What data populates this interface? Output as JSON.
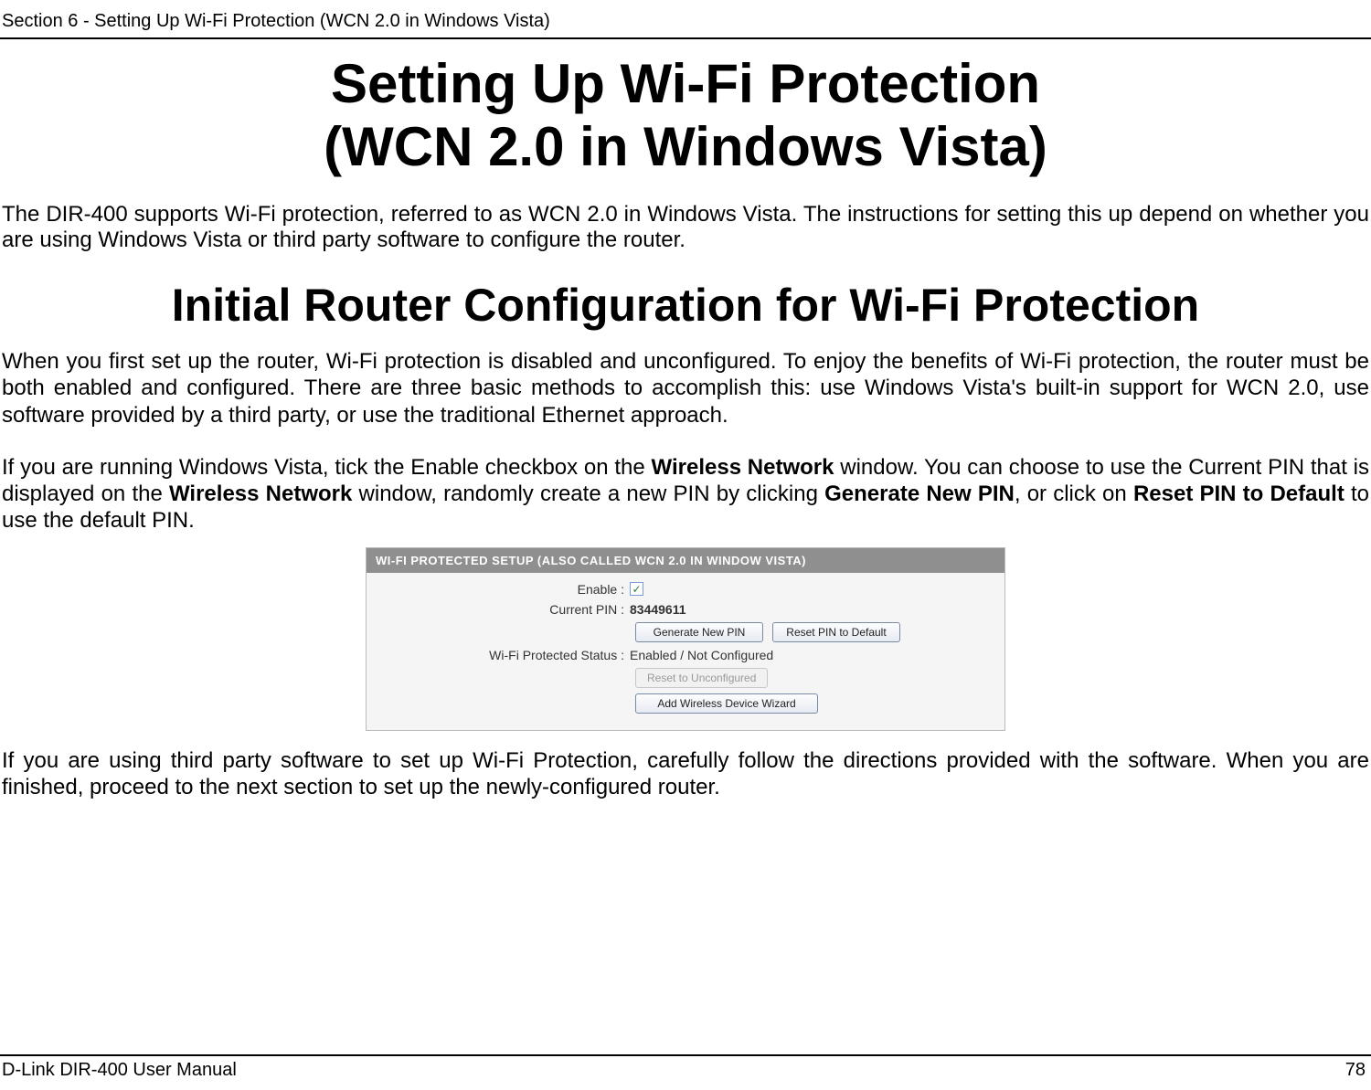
{
  "header": {
    "section_label": "Section 6 - Setting Up Wi-Fi Protection (WCN 2.0 in Windows Vista)"
  },
  "title": {
    "line1": "Setting Up Wi-Fi Protection",
    "line2": "(WCN 2.0 in Windows Vista)"
  },
  "intro": "The DIR-400 supports Wi-Fi protection, referred to as WCN 2.0 in Windows Vista. The instructions for setting this up depend on whether you are using Windows Vista or third party software to configure the router.",
  "subtitle": "Initial Router Configuration for Wi-Fi Protection",
  "para1": "When you first set up the router, Wi-Fi protection is disabled and unconfigured. To enjoy the benefits of Wi-Fi protection, the router must be both enabled and configured. There are three basic methods to accomplish this: use Windows Vista's built-in support for WCN 2.0, use software provided by a third party, or use the traditional Ethernet approach.",
  "para2_pre": "If you are running Windows Vista, tick the Enable checkbox on the ",
  "para2_b1": "Wireless Network",
  "para2_mid1": " window. You can choose to use the Current PIN that is displayed on the ",
  "para2_b2": "Wireless Network",
  "para2_mid2": " window, randomly create a new PIN by clicking ",
  "para2_b3": "Generate New PIN",
  "para2_mid3": ", or click on ",
  "para2_b4": "Reset PIN to Default",
  "para2_end": " to use the default PIN.",
  "panel": {
    "header": "WI-FI PROTECTED SETUP (ALSO CALLED WCN 2.0 IN WINDOW VISTA)",
    "enable_label": "Enable :",
    "enable_checked": "✓",
    "current_pin_label": "Current PIN :",
    "current_pin_value": "83449611",
    "btn_generate": "Generate New PIN",
    "btn_reset_pin": "Reset PIN to Default",
    "status_label": "Wi-Fi Protected Status :",
    "status_value": "Enabled / Not Configured",
    "btn_reset_unconfig": "Reset to Unconfigured",
    "btn_add_wizard": "Add Wireless Device Wizard"
  },
  "para3": "If you are using third party software to set up Wi-Fi Protection, carefully follow the directions provided with the software. When you are finished, proceed to the next section to set up the newly-configured router.",
  "footer": {
    "left": "D-Link DIR-400 User Manual",
    "right": "78"
  }
}
